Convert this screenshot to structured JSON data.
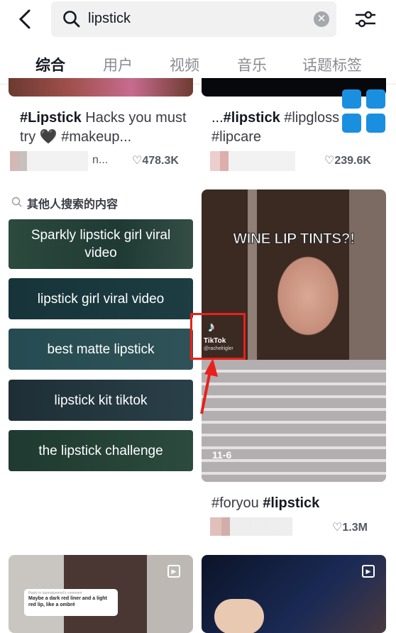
{
  "search": {
    "query": "lipstick"
  },
  "tabs": [
    {
      "label": "综合"
    },
    {
      "label": "用户"
    },
    {
      "label": "视频"
    },
    {
      "label": "音乐"
    },
    {
      "label": "话题标签"
    }
  ],
  "cards_top": [
    {
      "caption_bold": "#Lipstick",
      "caption_rest": " Hacks you must try 🖤 #makeup...",
      "author_suffix": "n...",
      "likes": "478.3K"
    },
    {
      "caption_pre": "...",
      "caption_bold": "#lipstick",
      "caption_rest": " #lipgloss #lipcare",
      "likes": "239.6K"
    }
  ],
  "others_searched": {
    "title": "其他人搜索的内容",
    "items": [
      "Sparkly lipstick girl viral video",
      "lipstick girl viral video",
      "best matte lipstick",
      "lipstick kit tiktok",
      "the lipstick challenge"
    ]
  },
  "featured_video": {
    "overlay_title": "WINE LIP TINTS?!",
    "watermark": "TikTok",
    "watermark_user": "@rachelrigler",
    "date": "11-6",
    "caption_pre": "#foryou ",
    "caption_bold": "#lipstick",
    "likes": "1.3M",
    "highlight_color": "#e8211b"
  },
  "bottom_cards": [
    {
      "comment_header": "Reply to karmakarenel's comment",
      "comment_text": "Maybe a dark red liner and a light red lip, like a ombré"
    },
    {}
  ],
  "colors": {
    "floating_button": "#1a8fe0"
  }
}
